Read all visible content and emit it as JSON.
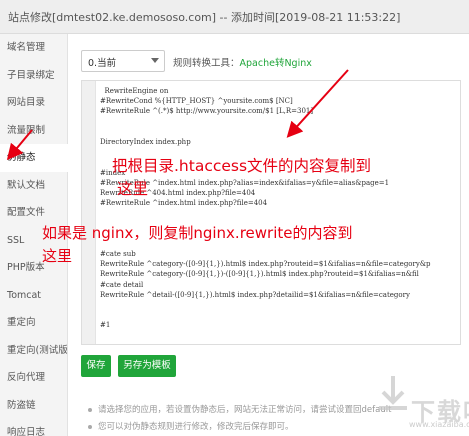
{
  "window": {
    "title": "站点修改[dmtest02.ke.demososo.com] -- 添加时间[2019-08-21 11:53:22]"
  },
  "sidebar": {
    "items": [
      {
        "label": "域名管理"
      },
      {
        "label": "子目录绑定"
      },
      {
        "label": "网站目录"
      },
      {
        "label": "流量限制"
      },
      {
        "label": "伪静态",
        "active": true
      },
      {
        "label": "默认文档"
      },
      {
        "label": "配置文件"
      },
      {
        "label": "SSL"
      },
      {
        "label": "PHP版本"
      },
      {
        "label": "Tomcat"
      },
      {
        "label": "重定向"
      },
      {
        "label": "重定向(测试版)"
      },
      {
        "label": "反向代理"
      },
      {
        "label": "防盗链"
      },
      {
        "label": "响应日志"
      }
    ]
  },
  "toolbar": {
    "select_value": "0.当前",
    "convert_label": "规则转换工具：",
    "convert_link": "Apache转Nginx"
  },
  "editor": {
    "lines": [
      "  RewriteEngine on",
      "#RewriteCond %{HTTP_HOST} ^yoursite.com$ [NC]",
      "#RewriteRule ^(.*)$ http://www.yoursite.com/$1 [L,R=301]",
      "",
      "",
      "DirectoryIndex index.php",
      "",
      "",
      "#index",
      "#RewriteRule ^index.html index.php?alias=index&ifalias=y&file=alias&page=1",
      "RewriteRule ^404.html index.php?file=404",
      "#RewriteRule ^index.html index.php?file=404",
      "",
      "",
      "",
      "",
      "#cate sub",
      "RewriteRule ^category-([0-9]{1,}).html$ index.php?routeid=$1&ifalias=n&file=category&p",
      "RewriteRule ^category-([0-9]{1,})-([0-9]{1,}).html$ index.php?routeid=$1&ifalias=n&fil",
      "#cate detail",
      "RewriteRule ^detail-([0-9]{1,}).html$ index.php?detailid=$1&ifalias=n&file=category",
      "",
      "",
      "#1"
    ]
  },
  "annotations": {
    "line1": "把根目录.htaccess文件的内容复制到",
    "line2": "这里",
    "line3": "如果是 nginx，则复制nginx.rewrite的内容到",
    "line4": "这里"
  },
  "buttons": {
    "save": "保存",
    "save_as": "另存为模板"
  },
  "tips": [
    "请选择您的应用，若设置伪静态后，网站无法正常访问，请尝试设置回default",
    "您可以对伪静态规则进行修改，修改完后保存即可。"
  ],
  "watermark": {
    "text": "下载吧",
    "sub": "www.xiazaiba.com"
  },
  "colors": {
    "accent": "#20a53a",
    "annotation": "#e60012"
  }
}
